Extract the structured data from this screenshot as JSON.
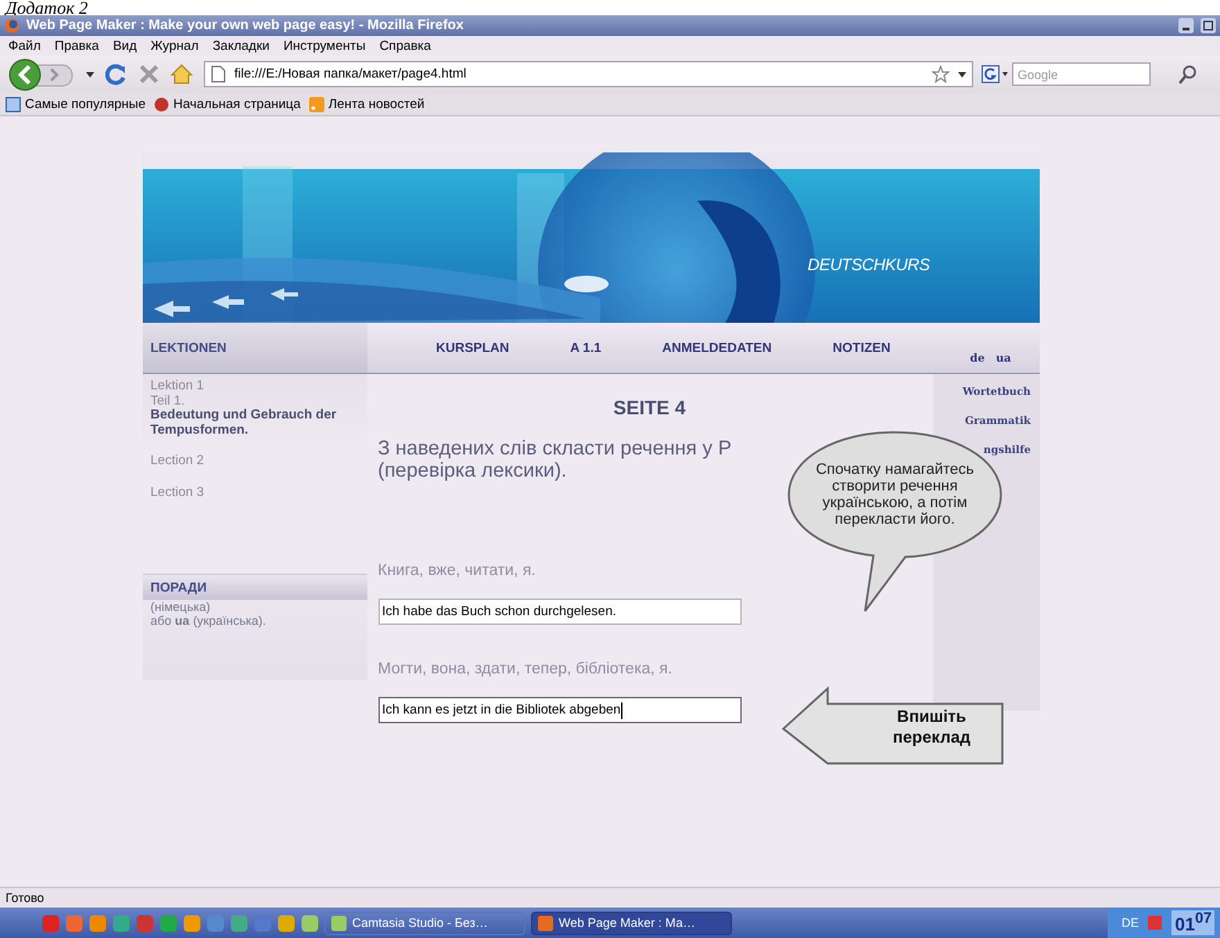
{
  "caption": "Додаток 2",
  "window": {
    "title": "Web Page Maker : Make your own web page easy! - Mozilla Firefox"
  },
  "menu": [
    "Файл",
    "Правка",
    "Вид",
    "Журнал",
    "Закладки",
    "Инструменты",
    "Справка"
  ],
  "address": {
    "value": "file:///E:/Новая папка/макет/page4.html"
  },
  "search": {
    "placeholder": "Google"
  },
  "bookmarks": [
    {
      "label": "Самые популярные",
      "kind": "page"
    },
    {
      "label": "Начальная страница",
      "kind": "home"
    },
    {
      "label": "Лента новостей",
      "kind": "feed"
    }
  ],
  "banner": {
    "title": "DEUTSCHKURS"
  },
  "nav": {
    "items": [
      "KURSPLAN",
      "A 1.1",
      "ANMELDEDATEN",
      "NOTIZEN"
    ],
    "languages": [
      "de",
      "ua"
    ]
  },
  "lessons": {
    "heading": "LEKTIONEN",
    "groups": [
      {
        "lines": [
          {
            "text": "Lektion 1",
            "bold": false
          },
          {
            "text": "Teil 1.",
            "bold": false
          },
          {
            "text": "Bedeutung und Gebrauch der Tempusformen.",
            "bold": true
          }
        ]
      },
      {
        "lines": [
          {
            "text": "Lection 2",
            "bold": false
          }
        ]
      },
      {
        "lines": [
          {
            "text": "Lection 3",
            "bold": false
          }
        ]
      }
    ]
  },
  "tips": {
    "heading": "ПОРАДИ",
    "lines": [
      "(німецька)",
      "або **ua** (українська)."
    ]
  },
  "page": {
    "title": "SEITE 4",
    "task": [
      "З наведених слів скласти речення у Р",
      "(перевірка лексики)."
    ],
    "exercises": [
      {
        "prompt": "Книга, вже, читати, я.",
        "answer": "Ich habe das Buch schon durchgelesen.",
        "focused": false
      },
      {
        "prompt": "Могти, вона, здати, тепер, бібліотека, я.",
        "answer": "Ich kann es jetzt in die Bibliotek abgeben",
        "focused": true
      }
    ]
  },
  "side_links": [
    "Wortetbuch",
    "Grammatik",
    "ngshilfe"
  ],
  "callouts": [
    {
      "kind": "bubble",
      "text": "Спочатку намагайтесь створити речення українською, а потім перекласти його."
    },
    {
      "kind": "arrow",
      "text": "Впишіть переклад"
    }
  ],
  "status_bar": "Готово",
  "taskbar": {
    "buttons": [
      {
        "label": "Camtasia Studio - Без…",
        "selected": false
      },
      {
        "label": "Web Page Maker : Ма…",
        "selected": true
      }
    ],
    "language": "DE",
    "clock": "01$^{07}$"
  }
}
